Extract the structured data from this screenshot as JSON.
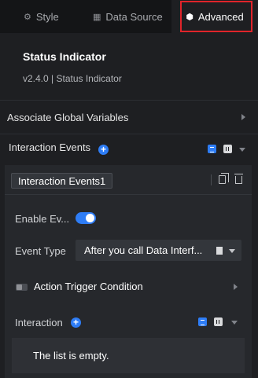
{
  "tabs": [
    {
      "label": "Style",
      "icon": "sliders-icon"
    },
    {
      "label": "Data Source",
      "icon": "grid-icon"
    },
    {
      "label": "Advanced",
      "icon": "cube-icon",
      "active": true
    }
  ],
  "component": {
    "title": "Status Indicator",
    "subtitle": "v2.4.0 | Status Indicator"
  },
  "sections": {
    "global_vars_label": "Associate Global Variables",
    "interaction_events_label": "Interaction Events"
  },
  "event_card": {
    "name": "Interaction Events1",
    "enable_label": "Enable Ev...",
    "enable_on": true,
    "event_type_label": "Event Type",
    "event_type_value": "After you call Data Interf...",
    "trigger_label": "Action Trigger Condition",
    "interaction_label": "Interaction",
    "empty_text": "The list is empty."
  },
  "colors": {
    "accent": "#2e7df6",
    "highlight_outline": "#e0242a",
    "background": "#1e1f22"
  }
}
